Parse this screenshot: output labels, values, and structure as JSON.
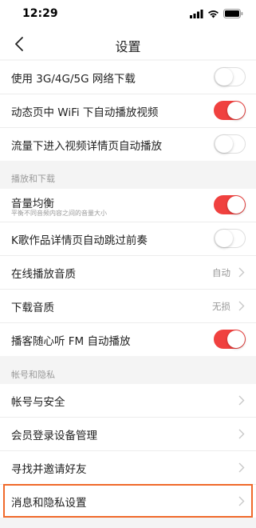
{
  "status_bar": {
    "time": "12:29"
  },
  "nav": {
    "title": "设置"
  },
  "group1": [
    {
      "label": "使用 3G/4G/5G 网络下载",
      "toggle": "off"
    },
    {
      "label": "动态页中 WiFi 下自动播放视频",
      "toggle": "on"
    },
    {
      "label": "流量下进入视频详情页自动播放",
      "toggle": "off"
    }
  ],
  "section_play": "播放和下载",
  "group2": {
    "volume": {
      "label": "音量均衡",
      "sub": "平衡不同音频内容之间的音量大小",
      "toggle": "on"
    },
    "ksong": {
      "label": "K歌作品详情页自动跳过前奏",
      "toggle": "off"
    },
    "online_quality": {
      "label": "在线播放音质",
      "value": "自动"
    },
    "download_quality": {
      "label": "下载音质",
      "value": "无损"
    },
    "podcast": {
      "label": "播客随心听 FM 自动播放",
      "toggle": "on"
    }
  },
  "section_account": "帐号和隐私",
  "group3": [
    {
      "label": "帐号与安全"
    },
    {
      "label": "会员登录设备管理"
    },
    {
      "label": "寻找并邀请好友"
    },
    {
      "label": "消息和隐私设置"
    }
  ],
  "colors": {
    "accent": "#f0413f",
    "highlight": "#f06a2b"
  }
}
